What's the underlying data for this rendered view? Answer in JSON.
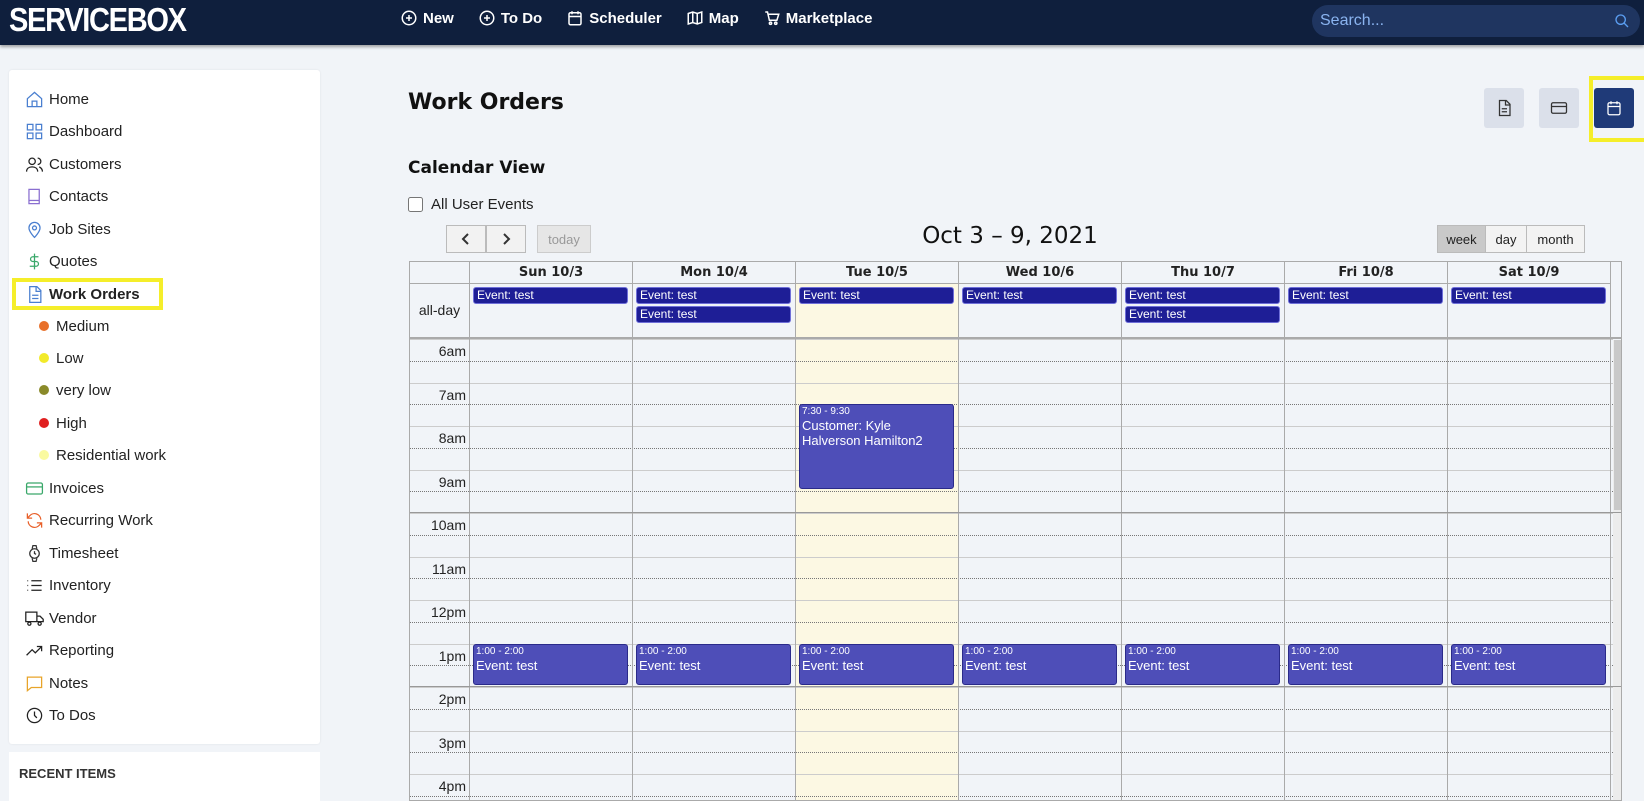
{
  "app": {
    "logo": "SERVICEBOX"
  },
  "topnav": [
    {
      "label": "New",
      "icon": "plus-circle-icon"
    },
    {
      "label": "To Do",
      "icon": "plus-circle-icon"
    },
    {
      "label": "Scheduler",
      "icon": "calendar-icon"
    },
    {
      "label": "Map",
      "icon": "map-icon"
    },
    {
      "label": "Marketplace",
      "icon": "cart-icon"
    }
  ],
  "search": {
    "placeholder": "Search..."
  },
  "sidebar": {
    "items": [
      {
        "label": "Home",
        "icon": "home-icon"
      },
      {
        "label": "Dashboard",
        "icon": "dashboard-icon"
      },
      {
        "label": "Customers",
        "icon": "users-icon"
      },
      {
        "label": "Contacts",
        "icon": "book-icon"
      },
      {
        "label": "Job Sites",
        "icon": "map-pin-icon"
      },
      {
        "label": "Quotes",
        "icon": "dollar-icon"
      },
      {
        "label": "Work Orders",
        "icon": "document-icon"
      }
    ],
    "sub_items": [
      {
        "label": "Medium",
        "color": "#e8702a"
      },
      {
        "label": "Low",
        "color": "#f2ea2a"
      },
      {
        "label": "very low",
        "color": "#8a8a2a"
      },
      {
        "label": "High",
        "color": "#e02020"
      },
      {
        "label": "Residential work",
        "color": "#fafaa0"
      }
    ],
    "items2": [
      {
        "label": "Invoices",
        "icon": "credit-card-icon"
      },
      {
        "label": "Recurring Work",
        "icon": "refresh-icon"
      },
      {
        "label": "Timesheet",
        "icon": "watch-icon"
      },
      {
        "label": "Inventory",
        "icon": "list-icon"
      },
      {
        "label": "Vendor",
        "icon": "truck-icon"
      },
      {
        "label": "Reporting",
        "icon": "trending-up-icon"
      },
      {
        "label": "Notes",
        "icon": "message-icon"
      },
      {
        "label": "To Dos",
        "icon": "clock-icon"
      }
    ],
    "recent_title": "RECENT ITEMS"
  },
  "main": {
    "title": "Work Orders",
    "section_title": "Calendar View",
    "all_user_events_label": "All User Events"
  },
  "calendar": {
    "range": "Oct 3 – 9, 2021",
    "today_label": "today",
    "views": [
      "week",
      "day",
      "month"
    ],
    "active_view": "week",
    "allday_label": "all-day",
    "days": [
      "Sun 10/3",
      "Mon 10/4",
      "Tue 10/5",
      "Wed 10/6",
      "Thu 10/7",
      "Fri 10/8",
      "Sat 10/9"
    ],
    "today_index": 2,
    "allday_events": [
      [
        "Event: test"
      ],
      [
        "Event: test",
        "Event: test"
      ],
      [
        "Event: test"
      ],
      [
        "Event: test"
      ],
      [
        "Event: test",
        "Event: test"
      ],
      [
        "Event: test"
      ],
      [
        "Event: test"
      ]
    ],
    "hours": [
      "6am",
      "7am",
      "8am",
      "9am",
      "10am",
      "11am",
      "12pm",
      "1pm",
      "2pm",
      "3pm",
      "4pm"
    ],
    "timed_events": [
      {
        "day": 2,
        "time": "7:30 - 9:30",
        "title": "Customer: Kyle Halverson Hamilton2"
      },
      {
        "day": 0,
        "time": "1:00 - 2:00",
        "title": "Event: test"
      },
      {
        "day": 1,
        "time": "1:00 - 2:00",
        "title": "Event: test"
      },
      {
        "day": 2,
        "time": "1:00 - 2:00",
        "title": "Event: test"
      },
      {
        "day": 3,
        "time": "1:00 - 2:00",
        "title": "Event: test"
      },
      {
        "day": 4,
        "time": "1:00 - 2:00",
        "title": "Event: test"
      },
      {
        "day": 5,
        "time": "1:00 - 2:00",
        "title": "Event: test"
      },
      {
        "day": 6,
        "time": "1:00 - 2:00",
        "title": "Event: test"
      }
    ],
    "event_color": "#1e1e96",
    "timed_event_color": "#4e4eb8",
    "today_color": "#fcf8e3"
  }
}
